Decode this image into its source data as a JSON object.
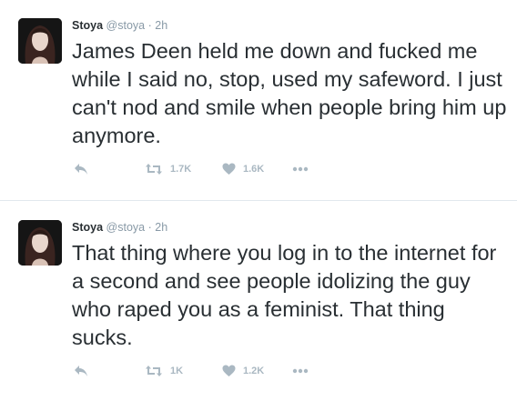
{
  "tweets": [
    {
      "name": "Stoya",
      "handle": "@stoya",
      "separator": "·",
      "time": "2h",
      "text": "James Deen held me down and fucked me while I said no, stop, used my safeword. I just can't nod and smile when people bring him up anymore.",
      "retweets": "1.7K",
      "likes": "1.6K"
    },
    {
      "name": "Stoya",
      "handle": "@stoya",
      "separator": "·",
      "time": "2h",
      "text": "That thing where you log in to the internet for a second and see people idolizing the guy who raped you as a feminist. That thing sucks.",
      "retweets": "1K",
      "likes": "1.2K"
    }
  ],
  "icons": {
    "reply": "reply-icon",
    "retweet": "retweet-icon",
    "like": "heart-icon",
    "more": "more-icon"
  },
  "colors": {
    "text": "#292f33",
    "muted": "#8899a6",
    "action": "#aab8c2",
    "divider": "#e1e8ed"
  }
}
